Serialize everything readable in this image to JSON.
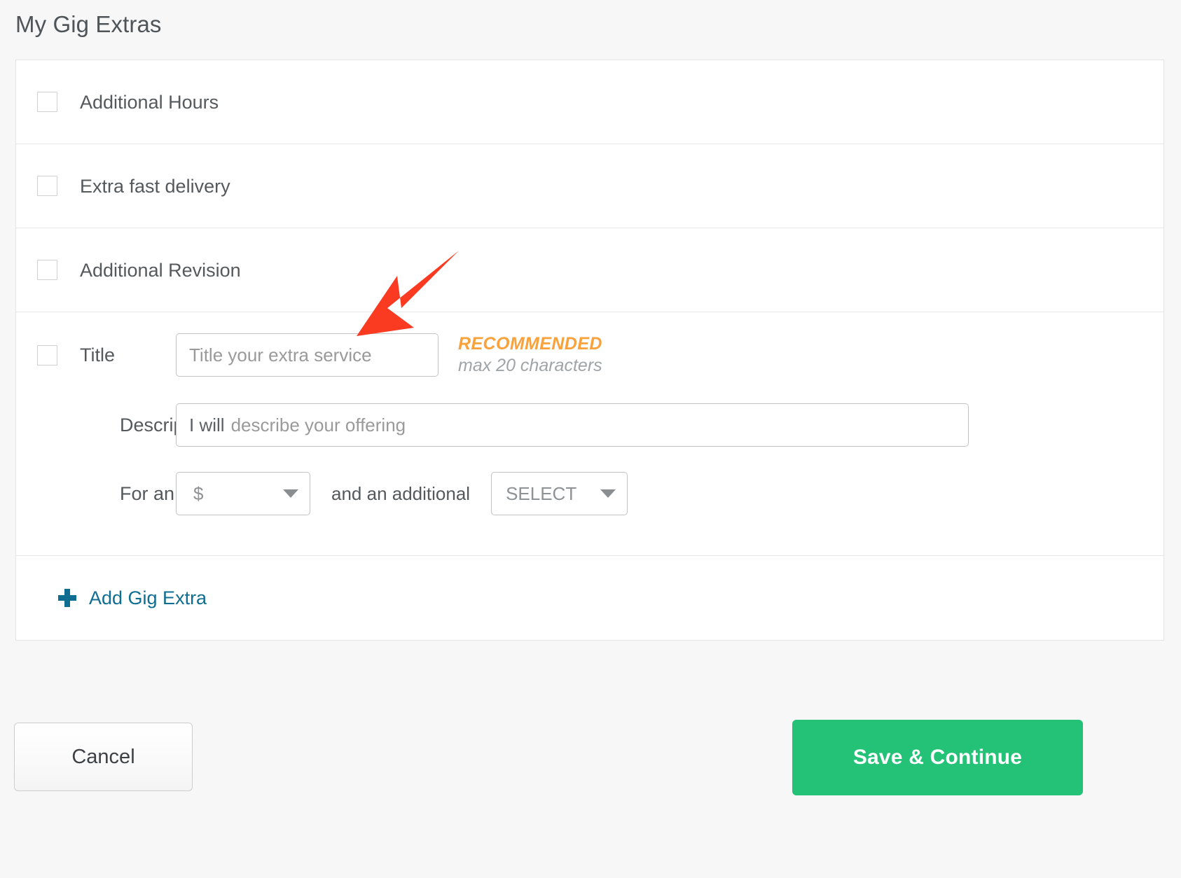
{
  "page": {
    "title": "My Gig Extras"
  },
  "extras": {
    "options": [
      {
        "label": "Additional Hours",
        "checked": false
      },
      {
        "label": "Extra fast delivery",
        "checked": false
      },
      {
        "label": "Additional Revision",
        "checked": false
      }
    ],
    "custom_extra": {
      "title_label": "Title",
      "title_placeholder": "Title your extra service",
      "title_value": "",
      "title_checked": false,
      "recommended_badge": "RECOMMENDED",
      "max_characters_hint": "max 20 characters",
      "description_label": "Description",
      "description_prefix": "I will",
      "description_placeholder": "describe your offering",
      "description_value": "",
      "price_label": "For an extra",
      "currency_value": "$",
      "between_text": "and an additional",
      "duration_value": "SELECT"
    },
    "add_extra_label": "Add Gig Extra",
    "add_extra_icon": "plus-icon"
  },
  "footer": {
    "cancel_label": "Cancel",
    "save_label": "Save & Continue"
  },
  "annotation": {
    "arrow_color": "#fa3a21",
    "arrow_icon": "arrow-down-left-icon"
  },
  "colors": {
    "accent_green": "#24c277",
    "link_blue": "#0f6d91",
    "recommended_orange": "#f9a13a",
    "page_background": "#f7f7f7"
  }
}
